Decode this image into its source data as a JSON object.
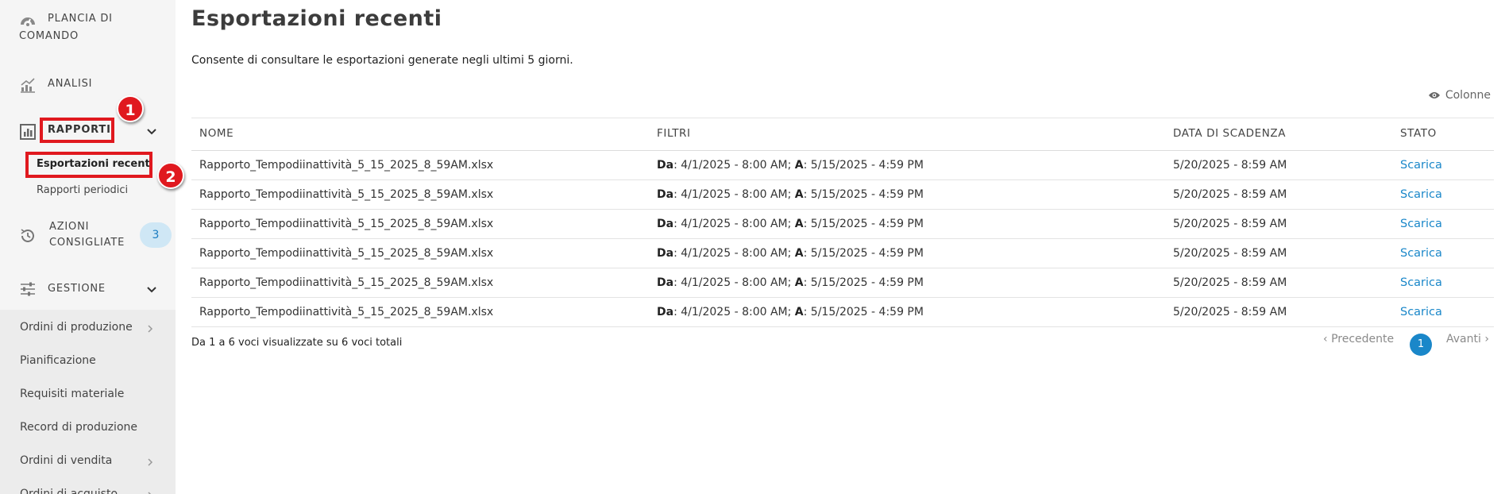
{
  "sidebar": {
    "dashboard_label_line1": "PLANCIA DI",
    "dashboard_label_line2": "COMANDO",
    "analysis_label": "ANALISI",
    "reports_label": "RAPPORTI",
    "reports_sub": [
      "Esportazioni recenti",
      "Rapporti periodici"
    ],
    "actions_label_line1": "AZIONI",
    "actions_label_line2": "CONSIGLIATE",
    "actions_count": "3",
    "management_label": "GESTIONE",
    "management_items": [
      "Ordini di produzione",
      "Pianificazione",
      "Requisiti materiale",
      "Record di produzione",
      "Ordini di vendita",
      "Ordini di acquisto"
    ]
  },
  "callouts": [
    "1",
    "2"
  ],
  "main": {
    "title": "Esportazioni recenti",
    "subtitle": "Consente di consultare le esportazioni generate negli ultimi 5 giorni.",
    "columns_button": "Colonne",
    "table": {
      "headers": [
        "NOME",
        "FILTRI",
        "DATA DI SCADENZA",
        "STATO"
      ],
      "filter_from_label": "Da",
      "filter_to_label": "A",
      "rows": [
        {
          "name": "Rapporto_Tempodiinattività_5_15_2025_8_59AM.xlsx",
          "from": ": 4/1/2025 - 8:00 AM; ",
          "to": ": 5/15/2025 - 4:59 PM",
          "expiry": "5/20/2025 - 8:59 AM",
          "status": "Scarica"
        },
        {
          "name": "Rapporto_Tempodiinattività_5_15_2025_8_59AM.xlsx",
          "from": ": 4/1/2025 - 8:00 AM; ",
          "to": ": 5/15/2025 - 4:59 PM",
          "expiry": "5/20/2025 - 8:59 AM",
          "status": "Scarica"
        },
        {
          "name": "Rapporto_Tempodiinattività_5_15_2025_8_59AM.xlsx",
          "from": ": 4/1/2025 - 8:00 AM; ",
          "to": ": 5/15/2025 - 4:59 PM",
          "expiry": "5/20/2025 - 8:59 AM",
          "status": "Scarica"
        },
        {
          "name": "Rapporto_Tempodiinattività_5_15_2025_8_59AM.xlsx",
          "from": ": 4/1/2025 - 8:00 AM; ",
          "to": ": 5/15/2025 - 4:59 PM",
          "expiry": "5/20/2025 - 8:59 AM",
          "status": "Scarica"
        },
        {
          "name": "Rapporto_Tempodiinattività_5_15_2025_8_59AM.xlsx",
          "from": ": 4/1/2025 - 8:00 AM; ",
          "to": ": 5/15/2025 - 4:59 PM",
          "expiry": "5/20/2025 - 8:59 AM",
          "status": "Scarica"
        },
        {
          "name": "Rapporto_Tempodiinattività_5_15_2025_8_59AM.xlsx",
          "from": ": 4/1/2025 - 8:00 AM; ",
          "to": ": 5/15/2025 - 4:59 PM",
          "expiry": "5/20/2025 - 8:59 AM",
          "status": "Scarica"
        }
      ]
    },
    "footer": {
      "info": "Da 1 a 6 voci visualizzate su 6 voci totali",
      "prev": "Precedente",
      "current_page": "1",
      "next": "Avanti"
    }
  },
  "colors": {
    "accent": "#1a87c9",
    "callout_red": "#e0191f",
    "badge_bg": "#cfe7f5",
    "sidebar_bg": "#f5f5f5"
  },
  "icons": [
    "dashboard-icon",
    "analysis-icon",
    "reports-icon",
    "history-icon",
    "sliders-icon",
    "chevron-down-icon",
    "chevron-right-icon",
    "eye-icon"
  ]
}
